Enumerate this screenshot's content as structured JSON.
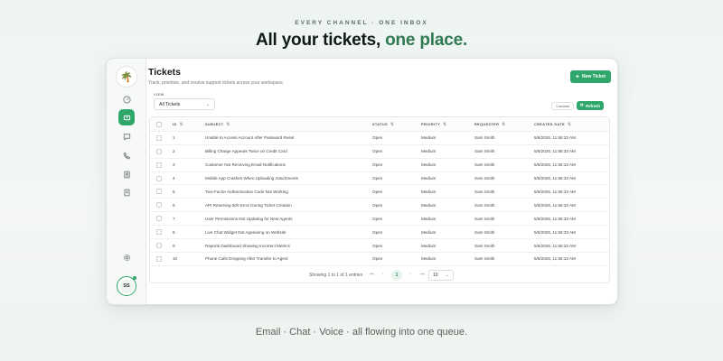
{
  "hero": {
    "eyebrow": "EVERY CHANNEL · ONE INBOX",
    "headline_main": "All your tickets, ",
    "headline_accent": "one place.",
    "footline": "Email · Chat · Voice · all flowing into one queue."
  },
  "colors": {
    "accent": "#2fa66a",
    "accent_dark": "#2f7a52",
    "background": "#eef5f1"
  },
  "sidebar": {
    "logo": "🌴",
    "items": [
      {
        "name": "dashboard-icon",
        "active": false
      },
      {
        "name": "tickets-icon",
        "active": true
      },
      {
        "name": "chat-icon",
        "active": false
      },
      {
        "name": "phone-icon",
        "active": false
      },
      {
        "name": "contacts-icon",
        "active": false
      },
      {
        "name": "reports-icon",
        "active": false
      }
    ],
    "settings_icon": "gear-icon",
    "avatar_initials": "SS"
  },
  "page": {
    "title": "Tickets",
    "subtitle": "Track, prioritize, and resolve support tickets across your workspace.",
    "new_button": "New Ticket",
    "view_label": "VIEW",
    "view_value": "All Tickets",
    "records": "1 records",
    "refresh_button": "Refresh"
  },
  "table": {
    "columns": {
      "id": "ID",
      "subject": "SUBJECT",
      "status": "STATUS",
      "priority": "PRIORITY",
      "requester": "REQUESTER",
      "created": "CREATED DATE"
    },
    "rows": [
      {
        "id": "1",
        "subject": "Unable to Access Account After Password Reset",
        "status": "Open",
        "priority": "Medium",
        "requester": "Sam Smith",
        "created": "5/6/2026, 11:56:33 AM"
      },
      {
        "id": "2",
        "subject": "Billing Charge Appears Twice on Credit Card",
        "status": "Open",
        "priority": "Medium",
        "requester": "Sam Smith",
        "created": "5/6/2026, 11:56:33 AM"
      },
      {
        "id": "3",
        "subject": "Customer Not Receiving Email Notifications",
        "status": "Open",
        "priority": "Medium",
        "requester": "Sam Smith",
        "created": "5/6/2026, 11:56:33 AM"
      },
      {
        "id": "4",
        "subject": "Mobile App Crashes When Uploading Attachments",
        "status": "Open",
        "priority": "Medium",
        "requester": "Sam Smith",
        "created": "5/6/2026, 11:56:33 AM"
      },
      {
        "id": "5",
        "subject": "Two-Factor Authentication Code Not Working",
        "status": "Open",
        "priority": "Medium",
        "requester": "Sam Smith",
        "created": "5/6/2026, 11:56:33 AM"
      },
      {
        "id": "6",
        "subject": "API Returning 500 Error During Ticket Creation",
        "status": "Open",
        "priority": "Medium",
        "requester": "Sam Smith",
        "created": "5/6/2026, 11:56:33 AM"
      },
      {
        "id": "7",
        "subject": "User Permissions Not Updating for New Agents",
        "status": "Open",
        "priority": "Medium",
        "requester": "Sam Smith",
        "created": "5/6/2026, 11:56:33 AM"
      },
      {
        "id": "8",
        "subject": "Live Chat Widget Not Appearing on Website",
        "status": "Open",
        "priority": "Medium",
        "requester": "Sam Smith",
        "created": "5/6/2026, 11:56:33 AM"
      },
      {
        "id": "9",
        "subject": "Reports Dashboard Showing Incorrect Metrics",
        "status": "Open",
        "priority": "Medium",
        "requester": "Sam Smith",
        "created": "5/6/2026, 11:56:33 AM"
      },
      {
        "id": "10",
        "subject": "Phone Calls Dropping After Transfer to Agent",
        "status": "Open",
        "priority": "Medium",
        "requester": "Sam Smith",
        "created": "5/6/2026, 11:56:33 AM"
      }
    ]
  },
  "pagination": {
    "summary": "Showing 1 to 1 of 1 entries",
    "current_page": "1",
    "page_size": "10"
  }
}
